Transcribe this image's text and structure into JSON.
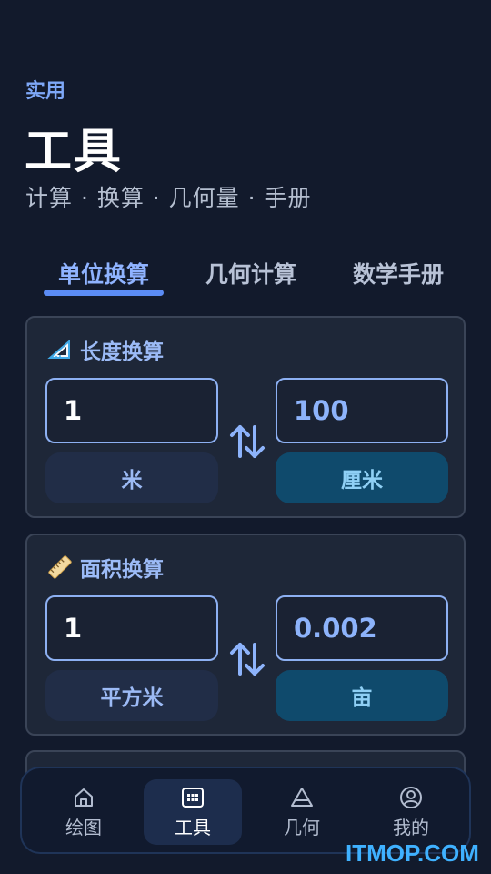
{
  "header": {
    "eyebrow": "实用",
    "title": "工具",
    "subtitle": "计算 · 换算 · 几何量 · 手册"
  },
  "tabs": [
    {
      "label": "单位换算",
      "active": true
    },
    {
      "label": "几何计算",
      "active": false
    },
    {
      "label": "数学手册",
      "active": false
    }
  ],
  "cards": [
    {
      "title": "长度换算",
      "icon": "set-square-icon",
      "from_value": "1",
      "to_value": "100",
      "from_unit": "米",
      "to_unit": "厘米"
    },
    {
      "title": "面积换算",
      "icon": "ruler-icon",
      "from_value": "1",
      "to_value": "0.002",
      "from_unit": "平方米",
      "to_unit": "亩"
    }
  ],
  "bottom_nav": [
    {
      "label": "绘图",
      "icon": "home-icon",
      "active": false
    },
    {
      "label": "工具",
      "icon": "keypad-icon",
      "active": true
    },
    {
      "label": "几何",
      "icon": "triangle-icon",
      "active": false
    },
    {
      "label": "我的",
      "icon": "user-icon",
      "active": false
    }
  ],
  "watermark": "ITMOP.COM",
  "colors": {
    "background": "#121a2c",
    "accent": "#5b8cf5",
    "active_unit": "#0f4a6c"
  }
}
